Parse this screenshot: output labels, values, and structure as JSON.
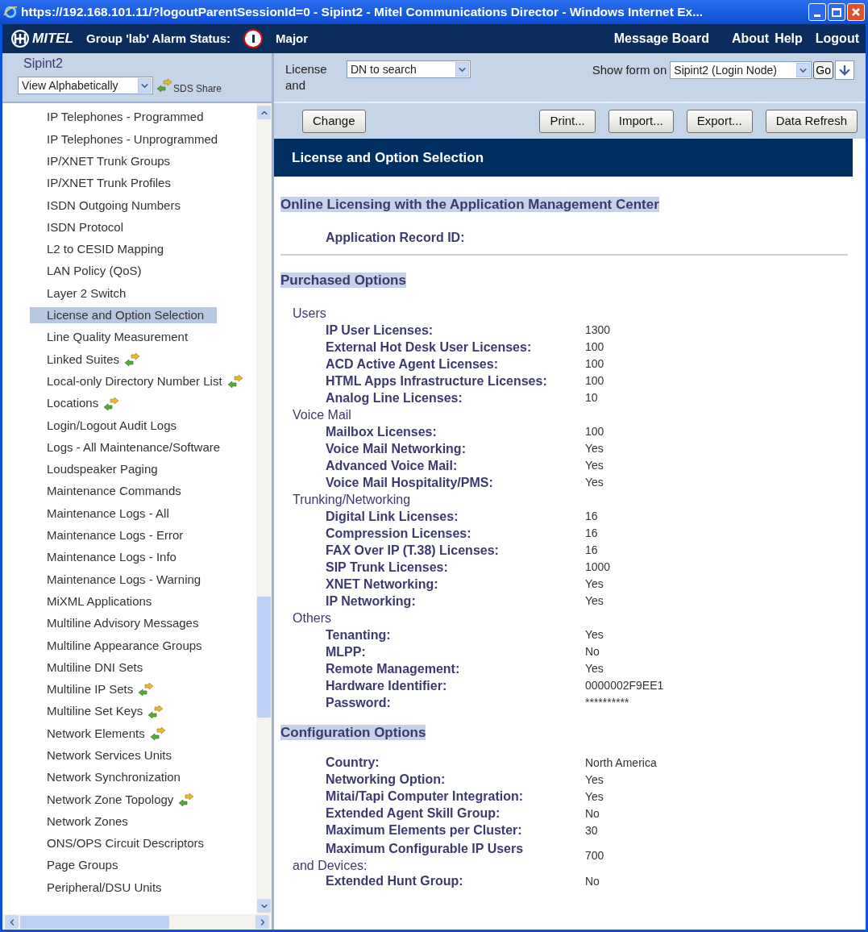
{
  "window": {
    "title": "https://192.168.101.11/?logoutParentSessionId=0 - Sipint2 - Mitel Communications Director - Windows Internet Ex..."
  },
  "header": {
    "logo": "MITEL",
    "alarm_label": "Group 'lab' Alarm Status:",
    "alarm_level": "Major",
    "links": [
      "Message Board",
      "About",
      "Help",
      "Logout"
    ]
  },
  "sidebar": {
    "node": "Sipint2",
    "view_select": "View Alphabetically",
    "sds_share": "SDS Share",
    "items": [
      {
        "label": "IP Telephones - Programmed",
        "selected": false,
        "shared": false
      },
      {
        "label": "IP Telephones - Unprogrammed",
        "selected": false,
        "shared": false
      },
      {
        "label": "IP/XNET Trunk Groups",
        "selected": false,
        "shared": false
      },
      {
        "label": "IP/XNET Trunk Profiles",
        "selected": false,
        "shared": false
      },
      {
        "label": "ISDN Outgoing Numbers",
        "selected": false,
        "shared": false
      },
      {
        "label": "ISDN Protocol",
        "selected": false,
        "shared": false
      },
      {
        "label": "L2 to CESID Mapping",
        "selected": false,
        "shared": false
      },
      {
        "label": "LAN Policy (QoS)",
        "selected": false,
        "shared": false
      },
      {
        "label": "Layer 2 Switch",
        "selected": false,
        "shared": false
      },
      {
        "label": "License and Option Selection",
        "selected": true,
        "shared": false
      },
      {
        "label": "Line Quality Measurement",
        "selected": false,
        "shared": false
      },
      {
        "label": "Linked Suites",
        "selected": false,
        "shared": true
      },
      {
        "label": "Local-only Directory Number List",
        "selected": false,
        "shared": true
      },
      {
        "label": "Locations",
        "selected": false,
        "shared": true
      },
      {
        "label": "Login/Logout Audit Logs",
        "selected": false,
        "shared": false
      },
      {
        "label": "Logs - All Maintenance/Software",
        "selected": false,
        "shared": false
      },
      {
        "label": "Loudspeaker Paging",
        "selected": false,
        "shared": false
      },
      {
        "label": "Maintenance Commands",
        "selected": false,
        "shared": false
      },
      {
        "label": "Maintenance Logs - All",
        "selected": false,
        "shared": false
      },
      {
        "label": "Maintenance Logs - Error",
        "selected": false,
        "shared": false
      },
      {
        "label": "Maintenance Logs - Info",
        "selected": false,
        "shared": false
      },
      {
        "label": "Maintenance Logs - Warning",
        "selected": false,
        "shared": false
      },
      {
        "label": "MiXML Applications",
        "selected": false,
        "shared": false
      },
      {
        "label": "Multiline Advisory Messages",
        "selected": false,
        "shared": false
      },
      {
        "label": "Multiline Appearance Groups",
        "selected": false,
        "shared": false
      },
      {
        "label": "Multiline DNI Sets",
        "selected": false,
        "shared": false
      },
      {
        "label": "Multiline IP Sets",
        "selected": false,
        "shared": true
      },
      {
        "label": "Multiline Set Keys",
        "selected": false,
        "shared": true
      },
      {
        "label": "Network Elements",
        "selected": false,
        "shared": true
      },
      {
        "label": "Network Services Units",
        "selected": false,
        "shared": false
      },
      {
        "label": "Network Synchronization",
        "selected": false,
        "shared": false
      },
      {
        "label": "Network Zone Topology",
        "selected": false,
        "shared": true
      },
      {
        "label": "Network Zones",
        "selected": false,
        "shared": false
      },
      {
        "label": "ONS/OPS Circuit Descriptors",
        "selected": false,
        "shared": false
      },
      {
        "label": "Page Groups",
        "selected": false,
        "shared": false
      },
      {
        "label": "Peripheral/DSU Units",
        "selected": false,
        "shared": false
      }
    ]
  },
  "toolbar": {
    "form_label": "License and",
    "search_select": "DN to search",
    "show_form_label": "Show form on",
    "node_select": "Sipint2 (Login Node)",
    "go": "Go",
    "buttons": [
      "Change",
      "Print...",
      "Import...",
      "Export...",
      "Data Refresh"
    ]
  },
  "form": {
    "title": "License and Option Selection",
    "online": {
      "heading": "Online Licensing with the Application Management Center",
      "record_label": "Application Record ID:"
    },
    "sections": [
      {
        "heading": "Purchased Options",
        "rows": [
          {
            "kind": "group",
            "label": "Users"
          },
          {
            "kind": "field",
            "label": "IP User Licenses:",
            "value": "1300"
          },
          {
            "kind": "field",
            "label": "External Hot Desk User Licenses:",
            "value": "100"
          },
          {
            "kind": "field",
            "label": "ACD Active Agent Licenses:",
            "value": "100"
          },
          {
            "kind": "field",
            "label": "HTML Apps Infrastructure Licenses:",
            "value": "100"
          },
          {
            "kind": "field",
            "label": "Analog Line Licenses:",
            "value": "10"
          },
          {
            "kind": "group",
            "label": "Voice Mail"
          },
          {
            "kind": "field",
            "label": "Mailbox Licenses:",
            "value": "100"
          },
          {
            "kind": "field",
            "label": "Voice Mail Networking:",
            "value": "Yes"
          },
          {
            "kind": "field",
            "label": "Advanced Voice Mail:",
            "value": "Yes"
          },
          {
            "kind": "field",
            "label": "Voice Mail Hospitality/PMS:",
            "value": "Yes"
          },
          {
            "kind": "group",
            "label": "Trunking/Networking"
          },
          {
            "kind": "field",
            "label": "Digital Link Licenses:",
            "value": "16"
          },
          {
            "kind": "field",
            "label": "Compression Licenses:",
            "value": "16"
          },
          {
            "kind": "field",
            "label": "FAX Over IP (T.38) Licenses:",
            "value": "16"
          },
          {
            "kind": "field",
            "label": "SIP Trunk Licenses:",
            "value": "1000"
          },
          {
            "kind": "field",
            "label": "XNET Networking:",
            "value": "Yes"
          },
          {
            "kind": "field",
            "label": "IP Networking:",
            "value": "Yes"
          },
          {
            "kind": "group",
            "label": "Others"
          },
          {
            "kind": "field",
            "label": "Tenanting:",
            "value": "Yes"
          },
          {
            "kind": "field",
            "label": "MLPP:",
            "value": "No"
          },
          {
            "kind": "field",
            "label": "Remote Management:",
            "value": "Yes"
          },
          {
            "kind": "field",
            "label": "Hardware Identifier:",
            "value": "0000002F9EE1"
          },
          {
            "kind": "field",
            "label": "Password:",
            "value": "**********"
          }
        ]
      },
      {
        "heading": "Configuration Options",
        "rows": [
          {
            "kind": "field",
            "label": "Country:",
            "value": "North America"
          },
          {
            "kind": "field",
            "label": "Networking Option:",
            "value": "Yes"
          },
          {
            "kind": "field",
            "label": "Mitai/Tapi Computer Integration:",
            "value": "Yes"
          },
          {
            "kind": "field",
            "label": "Extended Agent Skill Group:",
            "value": "No"
          },
          {
            "kind": "field",
            "label": "Maximum Elements per Cluster:",
            "value": "30"
          },
          {
            "kind": "wrapped",
            "label": "Maximum Configurable IP Users",
            "label_cont": "and Devices:",
            "value": "700"
          },
          {
            "kind": "field",
            "label": "Extended Hunt Group:",
            "value": "No"
          }
        ]
      }
    ]
  }
}
